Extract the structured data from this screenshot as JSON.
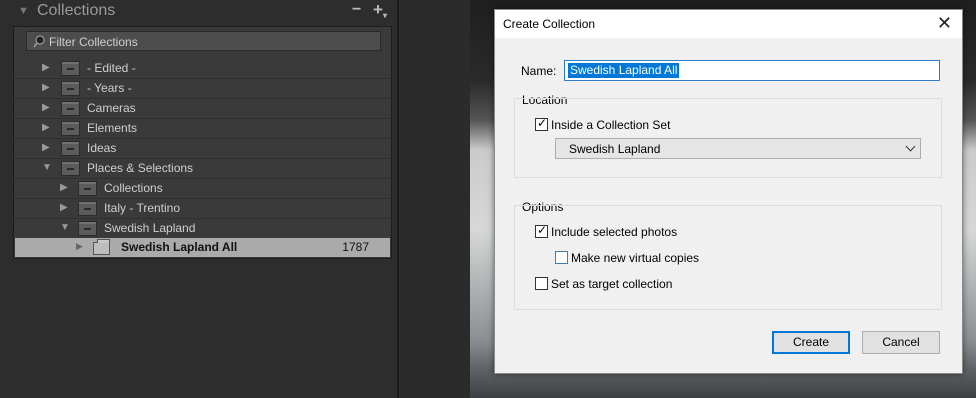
{
  "collections_panel": {
    "title": "Collections",
    "minus_label": "−",
    "plus_label": "+",
    "filter_placeholder": "Filter Collections",
    "items": [
      {
        "label": "- Edited -"
      },
      {
        "label": "- Years -"
      },
      {
        "label": "Cameras"
      },
      {
        "label": "Elements"
      },
      {
        "label": "Ideas"
      },
      {
        "label": "Places & Selections"
      },
      {
        "label": "Collections"
      },
      {
        "label": "Italy - Trentino"
      },
      {
        "label": "Swedish Lapland"
      }
    ],
    "selected": {
      "label": "Swedish Lapland All",
      "count": "1787"
    }
  },
  "dialog": {
    "title": "Create Collection",
    "close_label": "✕",
    "name_label": "Name:",
    "name_value": "Swedish Lapland All",
    "location_label": "Location",
    "inside_set_label": "Inside a Collection Set",
    "inside_set_checked": true,
    "set_value": "Swedish Lapland",
    "options_label": "Options",
    "include_selected_label": "Include selected photos",
    "include_selected_checked": true,
    "virtual_copies_label": "Make new virtual copies",
    "virtual_copies_checked": false,
    "target_label": "Set as target collection",
    "target_checked": false,
    "create_label": "Create",
    "cancel_label": "Cancel"
  },
  "colors": {
    "panel_bg": "#3a3a3a",
    "selection_bg": "#aaaaaa",
    "accent": "#0078d7"
  }
}
